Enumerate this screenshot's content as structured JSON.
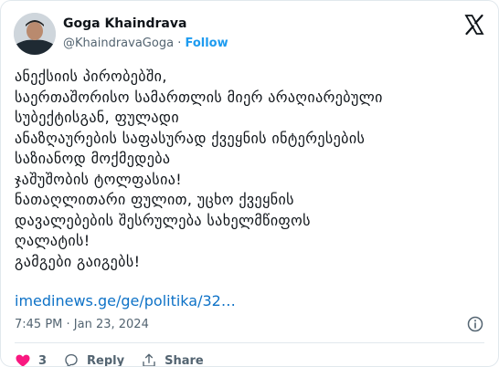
{
  "user": {
    "name": "Goga Khaindrava",
    "handle": "@KhaindravaGoga",
    "separator": "·",
    "follow_label": "Follow"
  },
  "tweet": {
    "text": "ანექსიის პირობებში,\nსაერთაშორისო სამართლის მიერ არაღიარებული\nსუბექტისგან, ფულადი\nანაზღაურების საფასურად ქვეყნის ინტერესების\nსაზიანოდ მოქმედება\nჯაშუშობის ტოლფასია!\nნათაღლითარი ფულით, უცხო ქვეყნის\nდავალებების შესრულება სახელმწიფოს\nღალატის!\nგამგები გაიგებს!",
    "link": "imedinews.ge/ge/politika/32…",
    "timestamp": "7:45 PM · Jan 23, 2024"
  },
  "actions": {
    "like_count": "3",
    "reply_label": "Reply",
    "share_label": "Share"
  },
  "icons": {
    "logo": "x-logo-icon",
    "info": "info-icon",
    "like": "heart-icon",
    "reply": "reply-icon",
    "share": "share-icon"
  },
  "colors": {
    "accent": "#1d9bf0",
    "link": "#0e72c7",
    "like": "#f91880",
    "muted": "#536471"
  }
}
